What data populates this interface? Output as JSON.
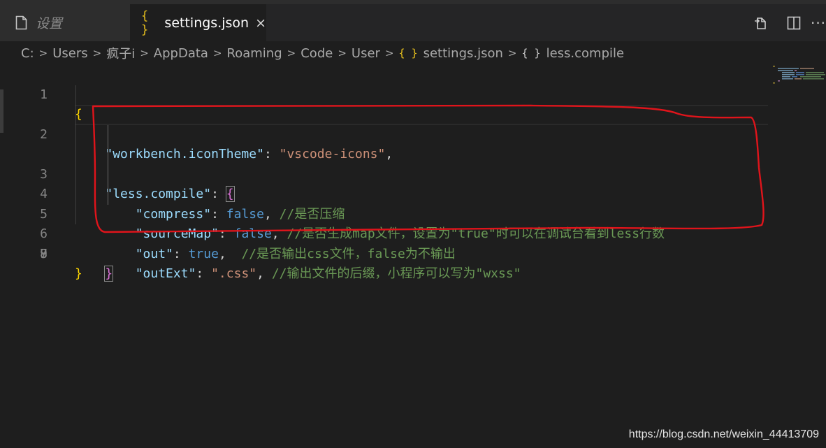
{
  "tabs": [
    {
      "label": "设置",
      "active": false,
      "icon": "file-icon"
    },
    {
      "label": "settings.json",
      "active": true,
      "icon": "json-braces-icon",
      "close": "×"
    }
  ],
  "actions": {
    "open_changes": "open-changes-icon",
    "split": "split-editor-icon",
    "more": "···"
  },
  "breadcrumb": {
    "parts": [
      "C:",
      "Users",
      "疯子i",
      "AppData",
      "Roaming",
      "Code",
      "User"
    ],
    "file": "settings.json",
    "symbol": "less.compile",
    "json_icon": "{ }",
    "separator": ">"
  },
  "editor": {
    "line_numbers": [
      "1",
      "2",
      "3",
      "4",
      "5",
      "6",
      "7",
      "8",
      "9"
    ],
    "lines": {
      "l1": {
        "open": "{"
      },
      "l2": {
        "key": "\"workbench.iconTheme\"",
        "colon": ": ",
        "value": "\"vscode-icons\"",
        "comma": ","
      },
      "l3": {
        "key": "\"less.compile\"",
        "colon": ": ",
        "open": "{"
      },
      "l4": {
        "key": "\"compress\"",
        "colon": ": ",
        "value": "false",
        "comma": ", ",
        "comment": "//是否压缩"
      },
      "l5": {
        "key": "\"sourceMap\"",
        "colon": ": ",
        "value": "false",
        "comma": ", ",
        "comment": "//是否生成map文件，设置为\"true\"时可以在调试台看到less行数"
      },
      "l6": {
        "key": "\"out\"",
        "colon": ": ",
        "value": "true",
        "comma": ",  ",
        "comment": "//是否输出css文件，false为不输出"
      },
      "l7": {
        "key": "\"outExt\"",
        "colon": ": ",
        "value": "\".css\"",
        "comma": ", ",
        "comment": "//输出文件的后缀，小程序可以写为\"wxss\""
      },
      "l8": {
        "close": "}"
      },
      "l9": {
        "close": "}"
      }
    }
  },
  "colors": {
    "annotation": "#e0141b",
    "brace_level1": "#ffd700",
    "brace_level2": "#da70d6"
  },
  "watermark": "https://blog.csdn.net/weixin_44413709"
}
